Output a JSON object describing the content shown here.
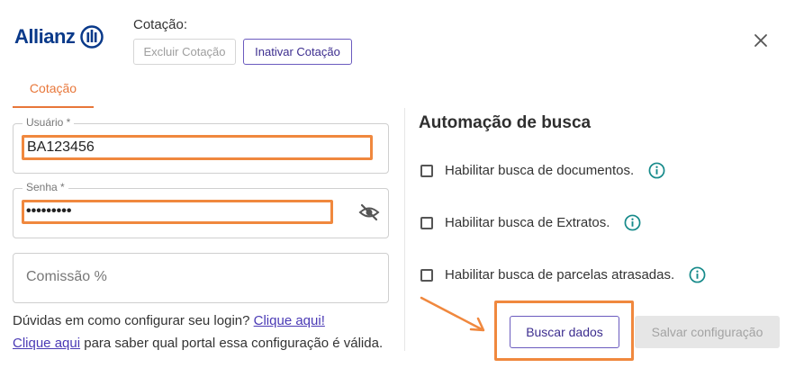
{
  "brand": {
    "name": "Allianz",
    "color": "#0a3a8a"
  },
  "header": {
    "cotacao_label": "Cotação:",
    "excluir_label": "Excluir Cotação",
    "inativar_label": "Inativar Cotação",
    "close_icon": "close-icon"
  },
  "tabs": [
    {
      "label": "Cotação",
      "active": true
    }
  ],
  "form": {
    "usuario": {
      "label": "Usuário *",
      "value": "BA123456"
    },
    "senha": {
      "label": "Senha *",
      "value": "•••••••••",
      "toggle_icon": "eye-off-icon"
    },
    "comissao": {
      "placeholder": "Comissão %"
    }
  },
  "help": {
    "line1_text": "Dúvidas em como configurar seu login? ",
    "line1_link": "Clique aqui!",
    "line2_link": "Clique aqui",
    "line2_text": " para saber qual portal essa configuração é válida."
  },
  "automation": {
    "title": "Automação de busca",
    "options": [
      {
        "label": "Habilitar busca de documentos.",
        "checked": false,
        "info_icon": "info-icon"
      },
      {
        "label": "Habilitar busca de Extratos.",
        "checked": false,
        "info_icon": "info-icon"
      },
      {
        "label": "Habilitar busca de parcelas atrasadas.",
        "checked": false,
        "info_icon": "info-icon"
      }
    ]
  },
  "actions": {
    "buscar_label": "Buscar dados",
    "salvar_label": "Salvar configuração"
  },
  "colors": {
    "accent_orange": "#f0883e",
    "primary_purple": "#3d2e8f",
    "info_teal": "#168a8a"
  }
}
